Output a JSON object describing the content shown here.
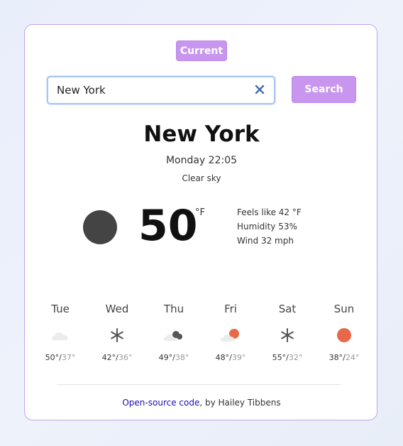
{
  "header": {
    "current_label": "Current"
  },
  "search": {
    "value": "New York",
    "button_label": "Search"
  },
  "weather": {
    "city": "New York",
    "datetime": "Monday 22:05",
    "description": "Clear sky",
    "temperature": "50",
    "unit": "°F",
    "feels_like": "Feels like 42 °F",
    "humidity": "Humidity 53%",
    "wind": "Wind 32 mph"
  },
  "forecast": [
    {
      "day": "Tue",
      "icon": "cloud-icon",
      "high": "50°",
      "low": "37°"
    },
    {
      "day": "Wed",
      "icon": "snowflake-icon",
      "high": "42°",
      "low": "36°"
    },
    {
      "day": "Thu",
      "icon": "cloudy-icon",
      "high": "49°",
      "low": "38°"
    },
    {
      "day": "Fri",
      "icon": "partly-cloudy-icon",
      "high": "48°",
      "low": "39°"
    },
    {
      "day": "Sat",
      "icon": "snowflake-icon",
      "high": "55°",
      "low": "32°"
    },
    {
      "day": "Sun",
      "icon": "sun-icon",
      "high": "38°",
      "low": "24°"
    }
  ],
  "footer": {
    "link_text": "Open-source code",
    "suffix": ", by Hailey Tibbens"
  },
  "colors": {
    "accent": "#c896ee",
    "moon": "#444444",
    "sun": "#e8694a"
  }
}
